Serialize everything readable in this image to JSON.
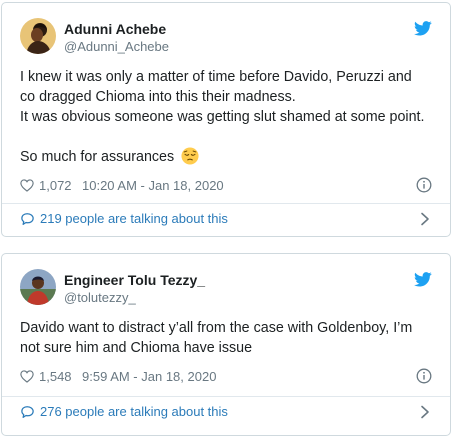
{
  "tweets": [
    {
      "author_name": "Adunni Achebe",
      "author_handle": "@Adunni_Achebe",
      "text_lines": [
        "I knew it was only a matter of time before Davido, Peruzzi and",
        "co dragged Chioma into this their madness.",
        "It was obvious someone was getting slut shamed at some point.",
        "",
        "So much for assurances"
      ],
      "emoji": "pensive-face",
      "likes": "1,072",
      "timestamp": "10:20 AM - Jan 18, 2020",
      "talking": "219 people are talking about this"
    },
    {
      "author_name": "Engineer Tolu Tezzy_",
      "author_handle": "@tolutezzy_",
      "text_lines": [
        "Davido want to distract y’all from the case with Goldenboy, I’m",
        "not sure him and Chioma have issue"
      ],
      "likes": "1,548",
      "timestamp": "9:59 AM - Jan 18, 2020",
      "talking": "276 people are talking about this"
    }
  ],
  "colors": {
    "twitter_blue": "#1da1f2",
    "link_blue": "#2b7bb9",
    "meta_gray": "#697882",
    "border": "#cfd9de"
  },
  "icons": {
    "brand": "twitter-bird-icon",
    "like": "heart-icon",
    "info": "info-icon",
    "talk": "speech-bubble-icon",
    "more": "chevron-right-icon"
  }
}
